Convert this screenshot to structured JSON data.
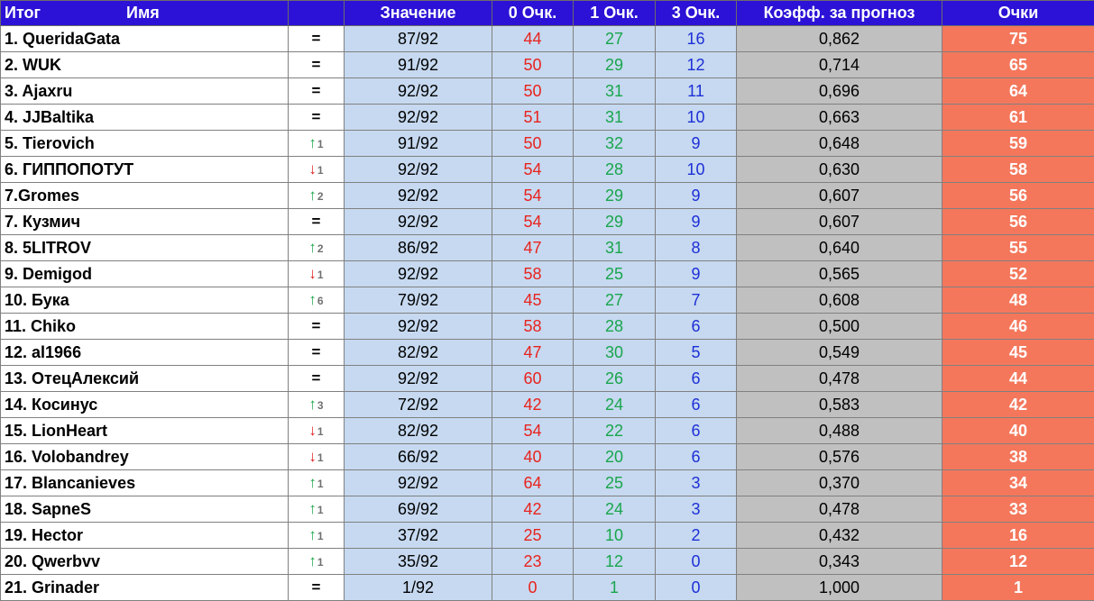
{
  "headers": {
    "itog": "Итог",
    "name": "Имя",
    "trend": "",
    "value": "Значение",
    "zero": "0 Очк.",
    "one": "1 Очк.",
    "three": "3 Очк.",
    "coef": "Коэфф. за прогноз",
    "points": "Очки"
  },
  "colors": {
    "header_bg": "#2b12d6",
    "value_bg": "#c6d9f0",
    "coef_bg": "#c0c0c0",
    "points_bg": "#f4775c",
    "zero_text": "#e8231e",
    "one_text": "#19a54c",
    "three_text": "#1d2fd6",
    "up_arrow": "#1aa84a",
    "down_arrow": "#e02020"
  },
  "rows": [
    {
      "name": "1. QueridaGata",
      "trend": "same",
      "trend_symbol": "=",
      "delta": "",
      "value": "87/92",
      "zero": "44",
      "one": "27",
      "three": "16",
      "coef": "0,862",
      "points": "75"
    },
    {
      "name": "2. WUK",
      "trend": "same",
      "trend_symbol": "=",
      "delta": "",
      "value": "91/92",
      "zero": "50",
      "one": "29",
      "three": "12",
      "coef": "0,714",
      "points": "65"
    },
    {
      "name": "3. Ajaxru",
      "trend": "same",
      "trend_symbol": "=",
      "delta": "",
      "value": "92/92",
      "zero": "50",
      "one": "31",
      "three": "11",
      "coef": "0,696",
      "points": "64"
    },
    {
      "name": "4. JJBaltika",
      "trend": "same",
      "trend_symbol": "=",
      "delta": "",
      "value": "92/92",
      "zero": "51",
      "one": "31",
      "three": "10",
      "coef": "0,663",
      "points": "61"
    },
    {
      "name": "5. Tierovich",
      "trend": "up",
      "trend_symbol": "↑",
      "delta": "1",
      "value": "91/92",
      "zero": "50",
      "one": "32",
      "three": "9",
      "coef": "0,648",
      "points": "59"
    },
    {
      "name": "6. ГИППОПОТУТ",
      "trend": "down",
      "trend_symbol": "↓",
      "delta": "1",
      "value": "92/92",
      "zero": "54",
      "one": "28",
      "three": "10",
      "coef": "0,630",
      "points": "58"
    },
    {
      "name": "7.Gromes",
      "trend": "up",
      "trend_symbol": "↑",
      "delta": "2",
      "value": "92/92",
      "zero": "54",
      "one": "29",
      "three": "9",
      "coef": "0,607",
      "points": "56"
    },
    {
      "name": "7. Кузмич",
      "trend": "same",
      "trend_symbol": "=",
      "delta": "",
      "value": "92/92",
      "zero": "54",
      "one": "29",
      "three": "9",
      "coef": "0,607",
      "points": "56"
    },
    {
      "name": "8. 5LITROV",
      "trend": "up",
      "trend_symbol": "↑",
      "delta": "2",
      "value": "86/92",
      "zero": "47",
      "one": "31",
      "three": "8",
      "coef": "0,640",
      "points": "55"
    },
    {
      "name": "9. Demigod",
      "trend": "down",
      "trend_symbol": "↓",
      "delta": "1",
      "value": "92/92",
      "zero": "58",
      "one": "25",
      "three": "9",
      "coef": "0,565",
      "points": "52"
    },
    {
      "name": "10. Бука",
      "trend": "up",
      "trend_symbol": "↑",
      "delta": "6",
      "value": "79/92",
      "zero": "45",
      "one": "27",
      "three": "7",
      "coef": "0,608",
      "points": "48"
    },
    {
      "name": "11. Chiko",
      "trend": "same",
      "trend_symbol": "=",
      "delta": "",
      "value": "92/92",
      "zero": "58",
      "one": "28",
      "three": "6",
      "coef": "0,500",
      "points": "46"
    },
    {
      "name": "12. al1966",
      "trend": "same",
      "trend_symbol": "=",
      "delta": "",
      "value": "82/92",
      "zero": "47",
      "one": "30",
      "three": "5",
      "coef": "0,549",
      "points": "45"
    },
    {
      "name": "13. ОтецАлексий",
      "trend": "same",
      "trend_symbol": "=",
      "delta": "",
      "value": "92/92",
      "zero": "60",
      "one": "26",
      "three": "6",
      "coef": "0,478",
      "points": "44"
    },
    {
      "name": "14. Косинус",
      "trend": "up",
      "trend_symbol": "↑",
      "delta": "3",
      "value": "72/92",
      "zero": "42",
      "one": "24",
      "three": "6",
      "coef": "0,583",
      "points": "42"
    },
    {
      "name": "15. LionHeart",
      "trend": "down",
      "trend_symbol": "↓",
      "delta": "1",
      "value": "82/92",
      "zero": "54",
      "one": "22",
      "three": "6",
      "coef": "0,488",
      "points": "40"
    },
    {
      "name": "16. Volobandrey",
      "trend": "down",
      "trend_symbol": "↓",
      "delta": "1",
      "value": "66/92",
      "zero": "40",
      "one": "20",
      "three": "6",
      "coef": "0,576",
      "points": "38"
    },
    {
      "name": "17. Blancanieves",
      "trend": "up",
      "trend_symbol": "↑",
      "delta": "1",
      "value": "92/92",
      "zero": "64",
      "one": "25",
      "three": "3",
      "coef": "0,370",
      "points": "34"
    },
    {
      "name": "18. SapneS",
      "trend": "up",
      "trend_symbol": "↑",
      "delta": "1",
      "value": "69/92",
      "zero": "42",
      "one": "24",
      "three": "3",
      "coef": "0,478",
      "points": "33"
    },
    {
      "name": "19. Hector",
      "trend": "up",
      "trend_symbol": "↑",
      "delta": "1",
      "value": "37/92",
      "zero": "25",
      "one": "10",
      "three": "2",
      "coef": "0,432",
      "points": "16"
    },
    {
      "name": "20. Qwerbvv",
      "trend": "up",
      "trend_symbol": "↑",
      "delta": "1",
      "value": "35/92",
      "zero": "23",
      "one": "12",
      "three": "0",
      "coef": "0,343",
      "points": "12"
    },
    {
      "name": "21. Grinader",
      "trend": "same",
      "trend_symbol": "=",
      "delta": "",
      "value": "1/92",
      "zero": "0",
      "one": "1",
      "three": "0",
      "coef": "1,000",
      "points": "1"
    }
  ]
}
